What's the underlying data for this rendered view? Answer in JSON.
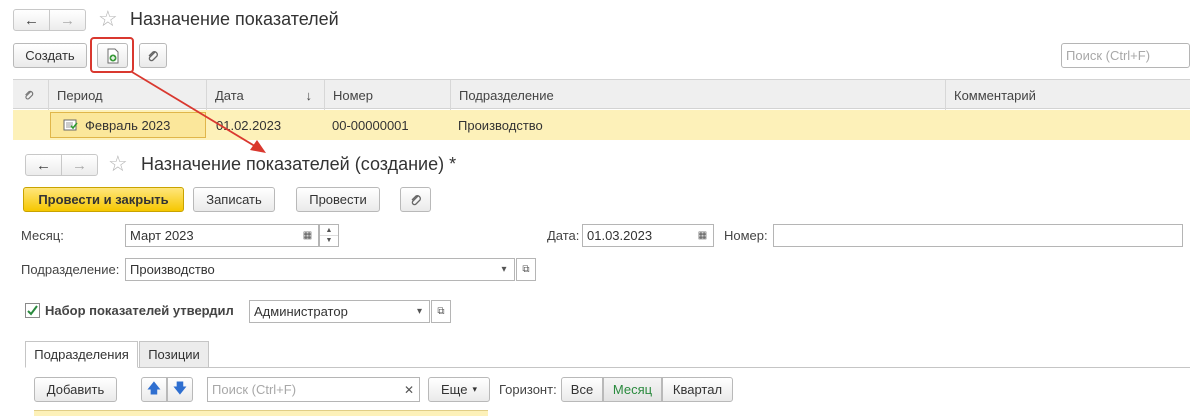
{
  "list_window": {
    "title": "Назначение показателей",
    "create_label": "Создать",
    "search_placeholder": "Поиск (Ctrl+F)",
    "columns": {
      "period": "Период",
      "date": "Дата",
      "date_sort": "↓",
      "number": "Номер",
      "division": "Подразделение",
      "comment": "Комментарий"
    },
    "rows": [
      {
        "period": "Февраль 2023",
        "date": "01.02.2023",
        "number": "00-00000001",
        "division": "Производство",
        "comment": ""
      }
    ]
  },
  "form": {
    "title": "Назначение показателей (создание) *",
    "post_close_label": "Провести и закрыть",
    "write_label": "Записать",
    "post_label": "Провести",
    "month_label": "Месяц:",
    "month_value": "Март 2023",
    "date_label": "Дата:",
    "date_value": "01.03.2023",
    "number_label": "Номер:",
    "number_value": "",
    "division_label": "Подразделение:",
    "division_value": "Производство",
    "approved_label": "Набор показателей утвердил",
    "approved_checked": true,
    "approved_value": "Администратор",
    "tabs": [
      {
        "label": "Подразделения",
        "active": true
      },
      {
        "label": "Позиции",
        "active": false
      }
    ],
    "add_label": "Добавить",
    "search_placeholder": "Поиск (Ctrl+F)",
    "more_label": "Еще",
    "horizon_label": "Горизонт:",
    "horizon_options": [
      "Все",
      "Месяц",
      "Квартал"
    ],
    "horizon_selected": "Месяц"
  },
  "icons": {
    "back": "arrow-left-icon",
    "forward": "arrow-right-icon",
    "favorite": "star-icon",
    "copy_doc": "add-document-icon",
    "attach": "paperclip-icon",
    "calendar": "calendar-icon",
    "open": "open-form-icon"
  },
  "colors": {
    "accent_yellow": "#f6c700",
    "row_highlight": "#fdf1b9",
    "callout_red": "#d9382f",
    "selected_green": "#2a8a3e"
  }
}
